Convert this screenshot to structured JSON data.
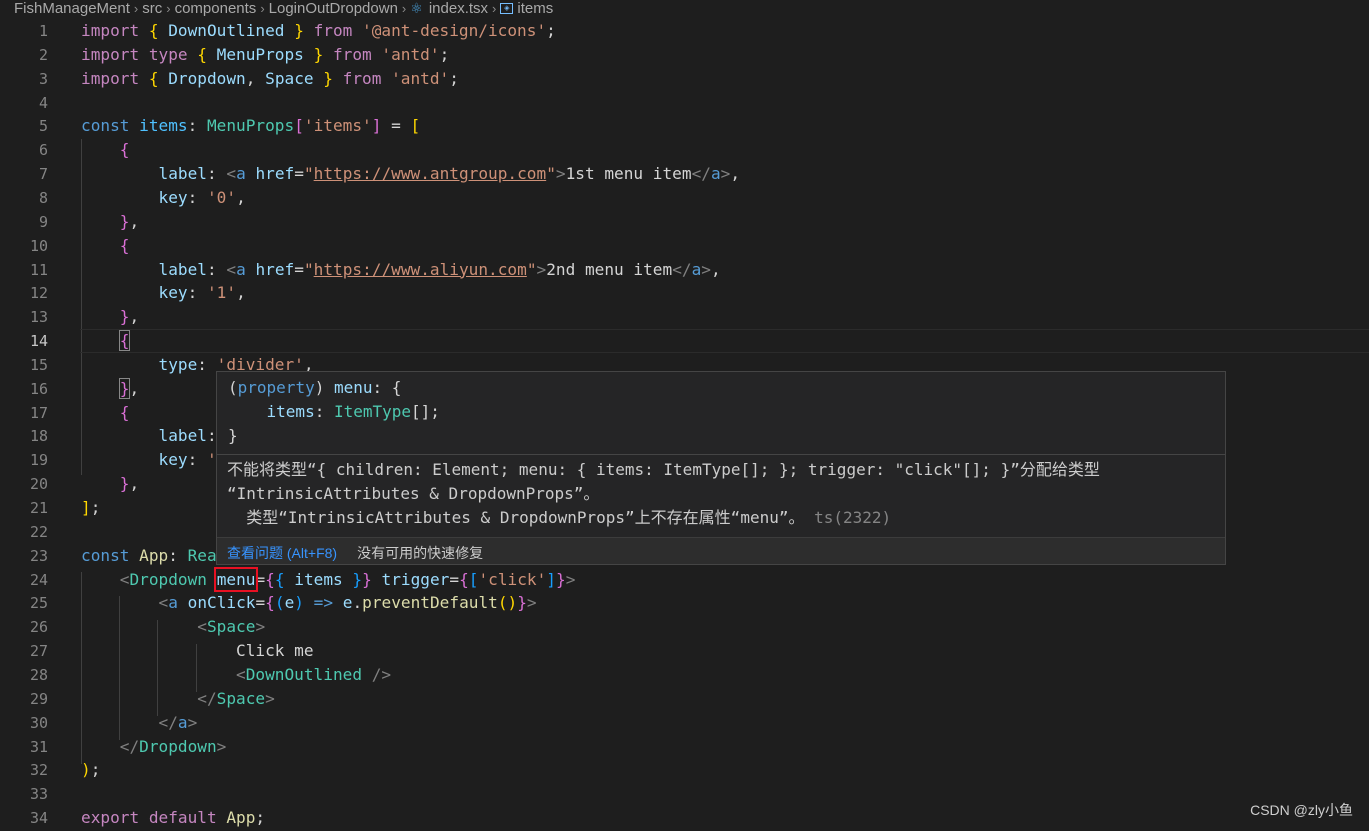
{
  "breadcrumb": [
    {
      "label": "FishManageMent",
      "icon": null
    },
    {
      "label": "src",
      "icon": null
    },
    {
      "label": "components",
      "icon": null
    },
    {
      "label": "LoginOutDropdown",
      "icon": null
    },
    {
      "label": "index.tsx",
      "icon": "react-file-icon"
    },
    {
      "label": "items",
      "icon": "symbol-variable-icon"
    }
  ],
  "editor": {
    "current_line": 14,
    "lines": [
      {
        "n": "1",
        "tokens": [
          [
            "kw",
            "import "
          ],
          [
            "b1",
            "{ "
          ],
          [
            "vr",
            "DownOutlined"
          ],
          [
            "b1",
            " }"
          ],
          [
            "kw",
            " from "
          ],
          [
            "str",
            "'@ant-design/icons'"
          ],
          [
            "tx",
            ";"
          ]
        ]
      },
      {
        "n": "2",
        "tokens": [
          [
            "kw",
            "import "
          ],
          [
            "kw",
            "type "
          ],
          [
            "b1",
            "{ "
          ],
          [
            "vr",
            "MenuProps"
          ],
          [
            "b1",
            " }"
          ],
          [
            "kw",
            " from "
          ],
          [
            "str",
            "'antd'"
          ],
          [
            "tx",
            ";"
          ]
        ]
      },
      {
        "n": "3",
        "tokens": [
          [
            "kw",
            "import "
          ],
          [
            "b1",
            "{ "
          ],
          [
            "vr",
            "Dropdown"
          ],
          [
            "tx",
            ", "
          ],
          [
            "vr",
            "Space"
          ],
          [
            "b1",
            " }"
          ],
          [
            "kw",
            " from "
          ],
          [
            "str",
            "'antd'"
          ],
          [
            "tx",
            ";"
          ]
        ]
      },
      {
        "n": "4",
        "tokens": []
      },
      {
        "n": "5",
        "tokens": [
          [
            "st",
            "const "
          ],
          [
            "cn",
            "items"
          ],
          [
            "tx",
            ": "
          ],
          [
            "ty",
            "MenuProps"
          ],
          [
            "b2",
            "["
          ],
          [
            "str",
            "'items'"
          ],
          [
            "b2",
            "]"
          ],
          [
            "tx",
            " = "
          ],
          [
            "b1",
            "["
          ]
        ]
      },
      {
        "n": "6",
        "tokens": [
          [
            "tx",
            "    "
          ],
          [
            "b2",
            "{"
          ]
        ]
      },
      {
        "n": "7",
        "tokens": [
          [
            "tx",
            "        "
          ],
          [
            "vr",
            "label"
          ],
          [
            "tx",
            ": "
          ],
          [
            "tg",
            "<"
          ],
          [
            "st",
            "a"
          ],
          [
            "tx",
            " "
          ],
          [
            "vr",
            "href"
          ],
          [
            "tx",
            "="
          ],
          [
            "str",
            "\""
          ],
          [
            "str url",
            "https://www.antgroup.com"
          ],
          [
            "str",
            "\""
          ],
          [
            "tg",
            ">"
          ],
          [
            "tx",
            "1st menu item"
          ],
          [
            "tg",
            "</"
          ],
          [
            "st",
            "a"
          ],
          [
            "tg",
            ">"
          ],
          [
            "tx",
            ","
          ]
        ]
      },
      {
        "n": "8",
        "tokens": [
          [
            "tx",
            "        "
          ],
          [
            "vr",
            "key"
          ],
          [
            "tx",
            ": "
          ],
          [
            "str",
            "'0'"
          ],
          [
            "tx",
            ","
          ]
        ]
      },
      {
        "n": "9",
        "tokens": [
          [
            "tx",
            "    "
          ],
          [
            "b2",
            "}"
          ],
          [
            "tx",
            ","
          ]
        ]
      },
      {
        "n": "10",
        "tokens": [
          [
            "tx",
            "    "
          ],
          [
            "b2",
            "{"
          ]
        ]
      },
      {
        "n": "11",
        "tokens": [
          [
            "tx",
            "        "
          ],
          [
            "vr",
            "label"
          ],
          [
            "tx",
            ": "
          ],
          [
            "tg",
            "<"
          ],
          [
            "st",
            "a"
          ],
          [
            "tx",
            " "
          ],
          [
            "vr",
            "href"
          ],
          [
            "tx",
            "="
          ],
          [
            "str",
            "\""
          ],
          [
            "str url",
            "https://www.aliyun.com"
          ],
          [
            "str",
            "\""
          ],
          [
            "tg",
            ">"
          ],
          [
            "tx",
            "2nd menu item"
          ],
          [
            "tg",
            "</"
          ],
          [
            "st",
            "a"
          ],
          [
            "tg",
            ">"
          ],
          [
            "tx",
            ","
          ]
        ]
      },
      {
        "n": "12",
        "tokens": [
          [
            "tx",
            "        "
          ],
          [
            "vr",
            "key"
          ],
          [
            "tx",
            ": "
          ],
          [
            "str",
            "'1'"
          ],
          [
            "tx",
            ","
          ]
        ]
      },
      {
        "n": "13",
        "tokens": [
          [
            "tx",
            "    "
          ],
          [
            "b2",
            "}"
          ],
          [
            "tx",
            ","
          ]
        ]
      },
      {
        "n": "14",
        "tokens": [
          [
            "tx",
            "    "
          ],
          [
            "b2 bm",
            "{"
          ]
        ]
      },
      {
        "n": "15",
        "tokens": [
          [
            "tx",
            "        "
          ],
          [
            "vr",
            "type"
          ],
          [
            "tx",
            ": "
          ],
          [
            "str",
            "'divider'"
          ],
          [
            "tx",
            ","
          ]
        ]
      },
      {
        "n": "16",
        "tokens": [
          [
            "tx",
            "    "
          ],
          [
            "b2 bm",
            "}"
          ],
          [
            "tx",
            ","
          ]
        ]
      },
      {
        "n": "17",
        "tokens": [
          [
            "tx",
            "    "
          ],
          [
            "b2",
            "{"
          ]
        ]
      },
      {
        "n": "18",
        "tokens": [
          [
            "tx",
            "        "
          ],
          [
            "vr",
            "label"
          ],
          [
            "tx",
            ":"
          ]
        ]
      },
      {
        "n": "19",
        "tokens": [
          [
            "tx",
            "        "
          ],
          [
            "vr",
            "key"
          ],
          [
            "tx",
            ": "
          ],
          [
            "str",
            "'"
          ]
        ]
      },
      {
        "n": "20",
        "tokens": [
          [
            "tx",
            "    "
          ],
          [
            "b2",
            "}"
          ],
          [
            "tx",
            ","
          ]
        ]
      },
      {
        "n": "21",
        "tokens": [
          [
            "b1",
            "]"
          ],
          [
            "tx",
            ";"
          ]
        ]
      },
      {
        "n": "22",
        "tokens": []
      },
      {
        "n": "23",
        "tokens": [
          [
            "st",
            "const "
          ],
          [
            "fn",
            "App"
          ],
          [
            "tx",
            ": "
          ],
          [
            "ty",
            "Rea"
          ]
        ]
      },
      {
        "n": "24",
        "tokens": [
          [
            "tx",
            "    "
          ],
          [
            "tg",
            "<"
          ],
          [
            "ty",
            "Dropdown"
          ],
          [
            "tx",
            " "
          ],
          [
            "vr errbox",
            "menu"
          ],
          [
            "tx",
            "="
          ],
          [
            "b2",
            "{"
          ],
          [
            "b3",
            "{"
          ],
          [
            "tx",
            " "
          ],
          [
            "vr",
            "items"
          ],
          [
            "tx",
            " "
          ],
          [
            "b3",
            "}"
          ],
          [
            "b2",
            "}"
          ],
          [
            "tx",
            " "
          ],
          [
            "vr",
            "trigger"
          ],
          [
            "tx",
            "="
          ],
          [
            "b2",
            "{"
          ],
          [
            "b3",
            "["
          ],
          [
            "str",
            "'click'"
          ],
          [
            "b3",
            "]"
          ],
          [
            "b2",
            "}"
          ],
          [
            "tg",
            ">"
          ]
        ]
      },
      {
        "n": "25",
        "tokens": [
          [
            "tx",
            "        "
          ],
          [
            "tg",
            "<"
          ],
          [
            "st",
            "a"
          ],
          [
            "tx",
            " "
          ],
          [
            "vr",
            "onClick"
          ],
          [
            "tx",
            "="
          ],
          [
            "b2",
            "{"
          ],
          [
            "b3",
            "("
          ],
          [
            "vr",
            "e"
          ],
          [
            "b3",
            ")"
          ],
          [
            "tx",
            " "
          ],
          [
            "st",
            "=>"
          ],
          [
            "tx",
            " "
          ],
          [
            "vr",
            "e"
          ],
          [
            "tx",
            "."
          ],
          [
            "fn",
            "preventDefault"
          ],
          [
            "b1",
            "()"
          ],
          [
            "b2",
            "}"
          ],
          [
            "tg",
            ">"
          ]
        ]
      },
      {
        "n": "26",
        "tokens": [
          [
            "tx",
            "            "
          ],
          [
            "tg",
            "<"
          ],
          [
            "ty",
            "Space"
          ],
          [
            "tg",
            ">"
          ]
        ]
      },
      {
        "n": "27",
        "tokens": [
          [
            "tx",
            "                Click me"
          ]
        ]
      },
      {
        "n": "28",
        "tokens": [
          [
            "tx",
            "                "
          ],
          [
            "tg",
            "<"
          ],
          [
            "ty",
            "DownOutlined"
          ],
          [
            "tx",
            " "
          ],
          [
            "tg",
            "/>"
          ]
        ]
      },
      {
        "n": "29",
        "tokens": [
          [
            "tx",
            "            "
          ],
          [
            "tg",
            "</"
          ],
          [
            "ty",
            "Space"
          ],
          [
            "tg",
            ">"
          ]
        ]
      },
      {
        "n": "30",
        "tokens": [
          [
            "tx",
            "        "
          ],
          [
            "tg",
            "</"
          ],
          [
            "st",
            "a"
          ],
          [
            "tg",
            ">"
          ]
        ]
      },
      {
        "n": "31",
        "tokens": [
          [
            "tx",
            "    "
          ],
          [
            "tg",
            "</"
          ],
          [
            "ty",
            "Dropdown"
          ],
          [
            "tg",
            ">"
          ]
        ]
      },
      {
        "n": "32",
        "tokens": [
          [
            "b1",
            ")"
          ],
          [
            "tx",
            ";"
          ]
        ]
      },
      {
        "n": "33",
        "tokens": []
      },
      {
        "n": "34",
        "tokens": [
          [
            "kw",
            "export "
          ],
          [
            "kw",
            "default "
          ],
          [
            "fn",
            "App"
          ],
          [
            "tx",
            ";"
          ]
        ]
      }
    ]
  },
  "hover": {
    "signature": [
      [
        [
          "tx",
          "("
        ],
        [
          "st",
          "property"
        ],
        [
          "tx",
          ") "
        ],
        [
          "vr",
          "menu"
        ],
        [
          "tx",
          ": {"
        ]
      ],
      [
        [
          "tx",
          "    "
        ],
        [
          "vr",
          "items"
        ],
        [
          "tx",
          ": "
        ],
        [
          "ty",
          "ItemType"
        ],
        [
          "tx",
          "[];"
        ]
      ],
      [
        [
          "tx",
          "}"
        ]
      ]
    ],
    "message_line1": "不能将类型“{ children: Element; menu: { items: ItemType[]; }; trigger: \"click\"[]; }”分配给类型",
    "message_line2": "“IntrinsicAttributes & DropdownProps”。",
    "message_line3": "  类型“IntrinsicAttributes & DropdownProps”上不存在属性“menu”。",
    "error_code": "ts(2322)",
    "action_view_problem": "查看问题 (Alt+F8)",
    "action_no_fix": "没有可用的快速修复"
  },
  "watermark": "CSDN @zly小鱼",
  "colors": {
    "background": "#1e1e1e",
    "error_box": "#e81123",
    "link": "#3794ff"
  }
}
